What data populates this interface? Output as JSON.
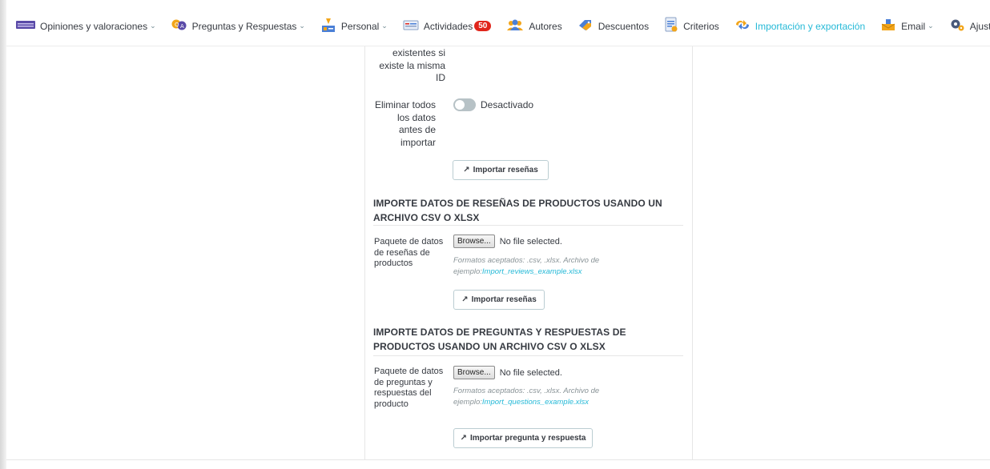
{
  "nav": [
    {
      "label": "Opiniones y valoraciones",
      "icon": "reviews-icon",
      "dropdown": true
    },
    {
      "label": "Preguntas y Respuestas",
      "icon": "questions-icon",
      "dropdown": true
    },
    {
      "label": "Personal",
      "icon": "staff-icon",
      "dropdown": true
    },
    {
      "label": "Actividades",
      "icon": "activities-icon",
      "badge": "50"
    },
    {
      "label": "Autores",
      "icon": "authors-icon"
    },
    {
      "label": "Descuentos",
      "icon": "discounts-icon"
    },
    {
      "label": "Criterios",
      "icon": "criteria-icon"
    },
    {
      "label": "Importación y exportación",
      "icon": "import-export-icon",
      "active": true
    },
    {
      "label": "Email",
      "icon": "email-icon",
      "dropdown": true
    },
    {
      "label": "Ajustes",
      "icon": "settings-icon"
    }
  ],
  "form": {
    "overwrite_label_tail": "existentes si existe la misma ID",
    "delete_all_label": "Eliminar todos los datos antes de importar",
    "delete_all_state": "Desactivado",
    "import_reviews_button": "Importar reseñas"
  },
  "reviews_section": {
    "title": "IMPORTE DATOS DE RESEÑAS DE PRODUCTOS USANDO UN ARCHIVO CSV O XLSX",
    "field_label": "Paquete de datos de reseñas de productos",
    "browse_label": "Browse...",
    "file_status": "No file selected.",
    "help_prefix": "Formatos aceptados: .csv, .xlsx. Archivo de ejemplo:",
    "help_link": "Import_reviews_example.xlsx",
    "button": "Importar reseñas"
  },
  "questions_section": {
    "title": "IMPORTE DATOS DE PREGUNTAS Y RESPUESTAS DE PRODUCTOS USANDO UN ARCHIVO CSV O XLSX",
    "field_label": "Paquete de datos de preguntas y respuestas del producto",
    "browse_label": "Browse...",
    "file_status": "No file selected.",
    "help_prefix": "Formatos aceptados: .csv, .xlsx. Archivo de ejemplo:",
    "help_link": "Import_questions_example.xlsx",
    "button": "Importar pregunta y respuesta"
  },
  "colors": {
    "accent": "#25b9d7",
    "badge": "#e0251b",
    "toggle_off": "#b7c2c6"
  }
}
